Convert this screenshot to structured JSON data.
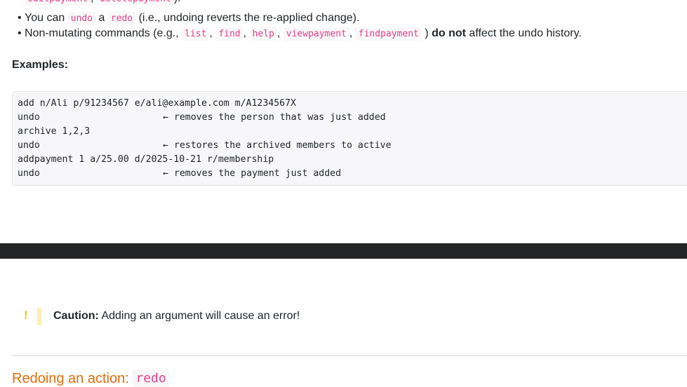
{
  "bullets": {
    "line0": {
      "code1": "editpayment",
      "sep": ",",
      "code2": "deletepayment",
      "tail": ")."
    },
    "line1": {
      "pre": "You can",
      "code1": "undo",
      "mid": "a",
      "code2": "redo",
      "tail": "(i.e., undoing reverts the re-applied change)."
    },
    "line2": {
      "pre": "Non-mutating commands (e.g.,",
      "codes": [
        "list",
        "find",
        "help",
        "viewpayment",
        "findpayment"
      ],
      "sep": ",",
      "close": ")",
      "bold": "do not",
      "tail": "affect the undo history."
    }
  },
  "examples": {
    "heading": "Examples:",
    "lines": [
      {
        "cmd": "add n/Ali p/91234567 e/ali@example.com m/A1234567X",
        "note": ""
      },
      {
        "cmd": "undo",
        "note": "← removes the person that was just added"
      },
      {
        "cmd": "archive 1,2,3",
        "note": ""
      },
      {
        "cmd": "undo",
        "note": "← restores the archived members to active"
      },
      {
        "cmd": "addpayment 1 a/25.00 d/2025-10-21 r/membership",
        "note": ""
      },
      {
        "cmd": "undo",
        "note": "← removes the payment just added"
      }
    ]
  },
  "caution": {
    "icon": "exclamation-icon",
    "glyph": "!",
    "label": "Caution:",
    "text": "Adding an argument will cause an error!",
    "accent": "#f2c21b"
  },
  "section": {
    "title": "Redoing an action:",
    "code": "redo",
    "color": "#e36c09"
  }
}
